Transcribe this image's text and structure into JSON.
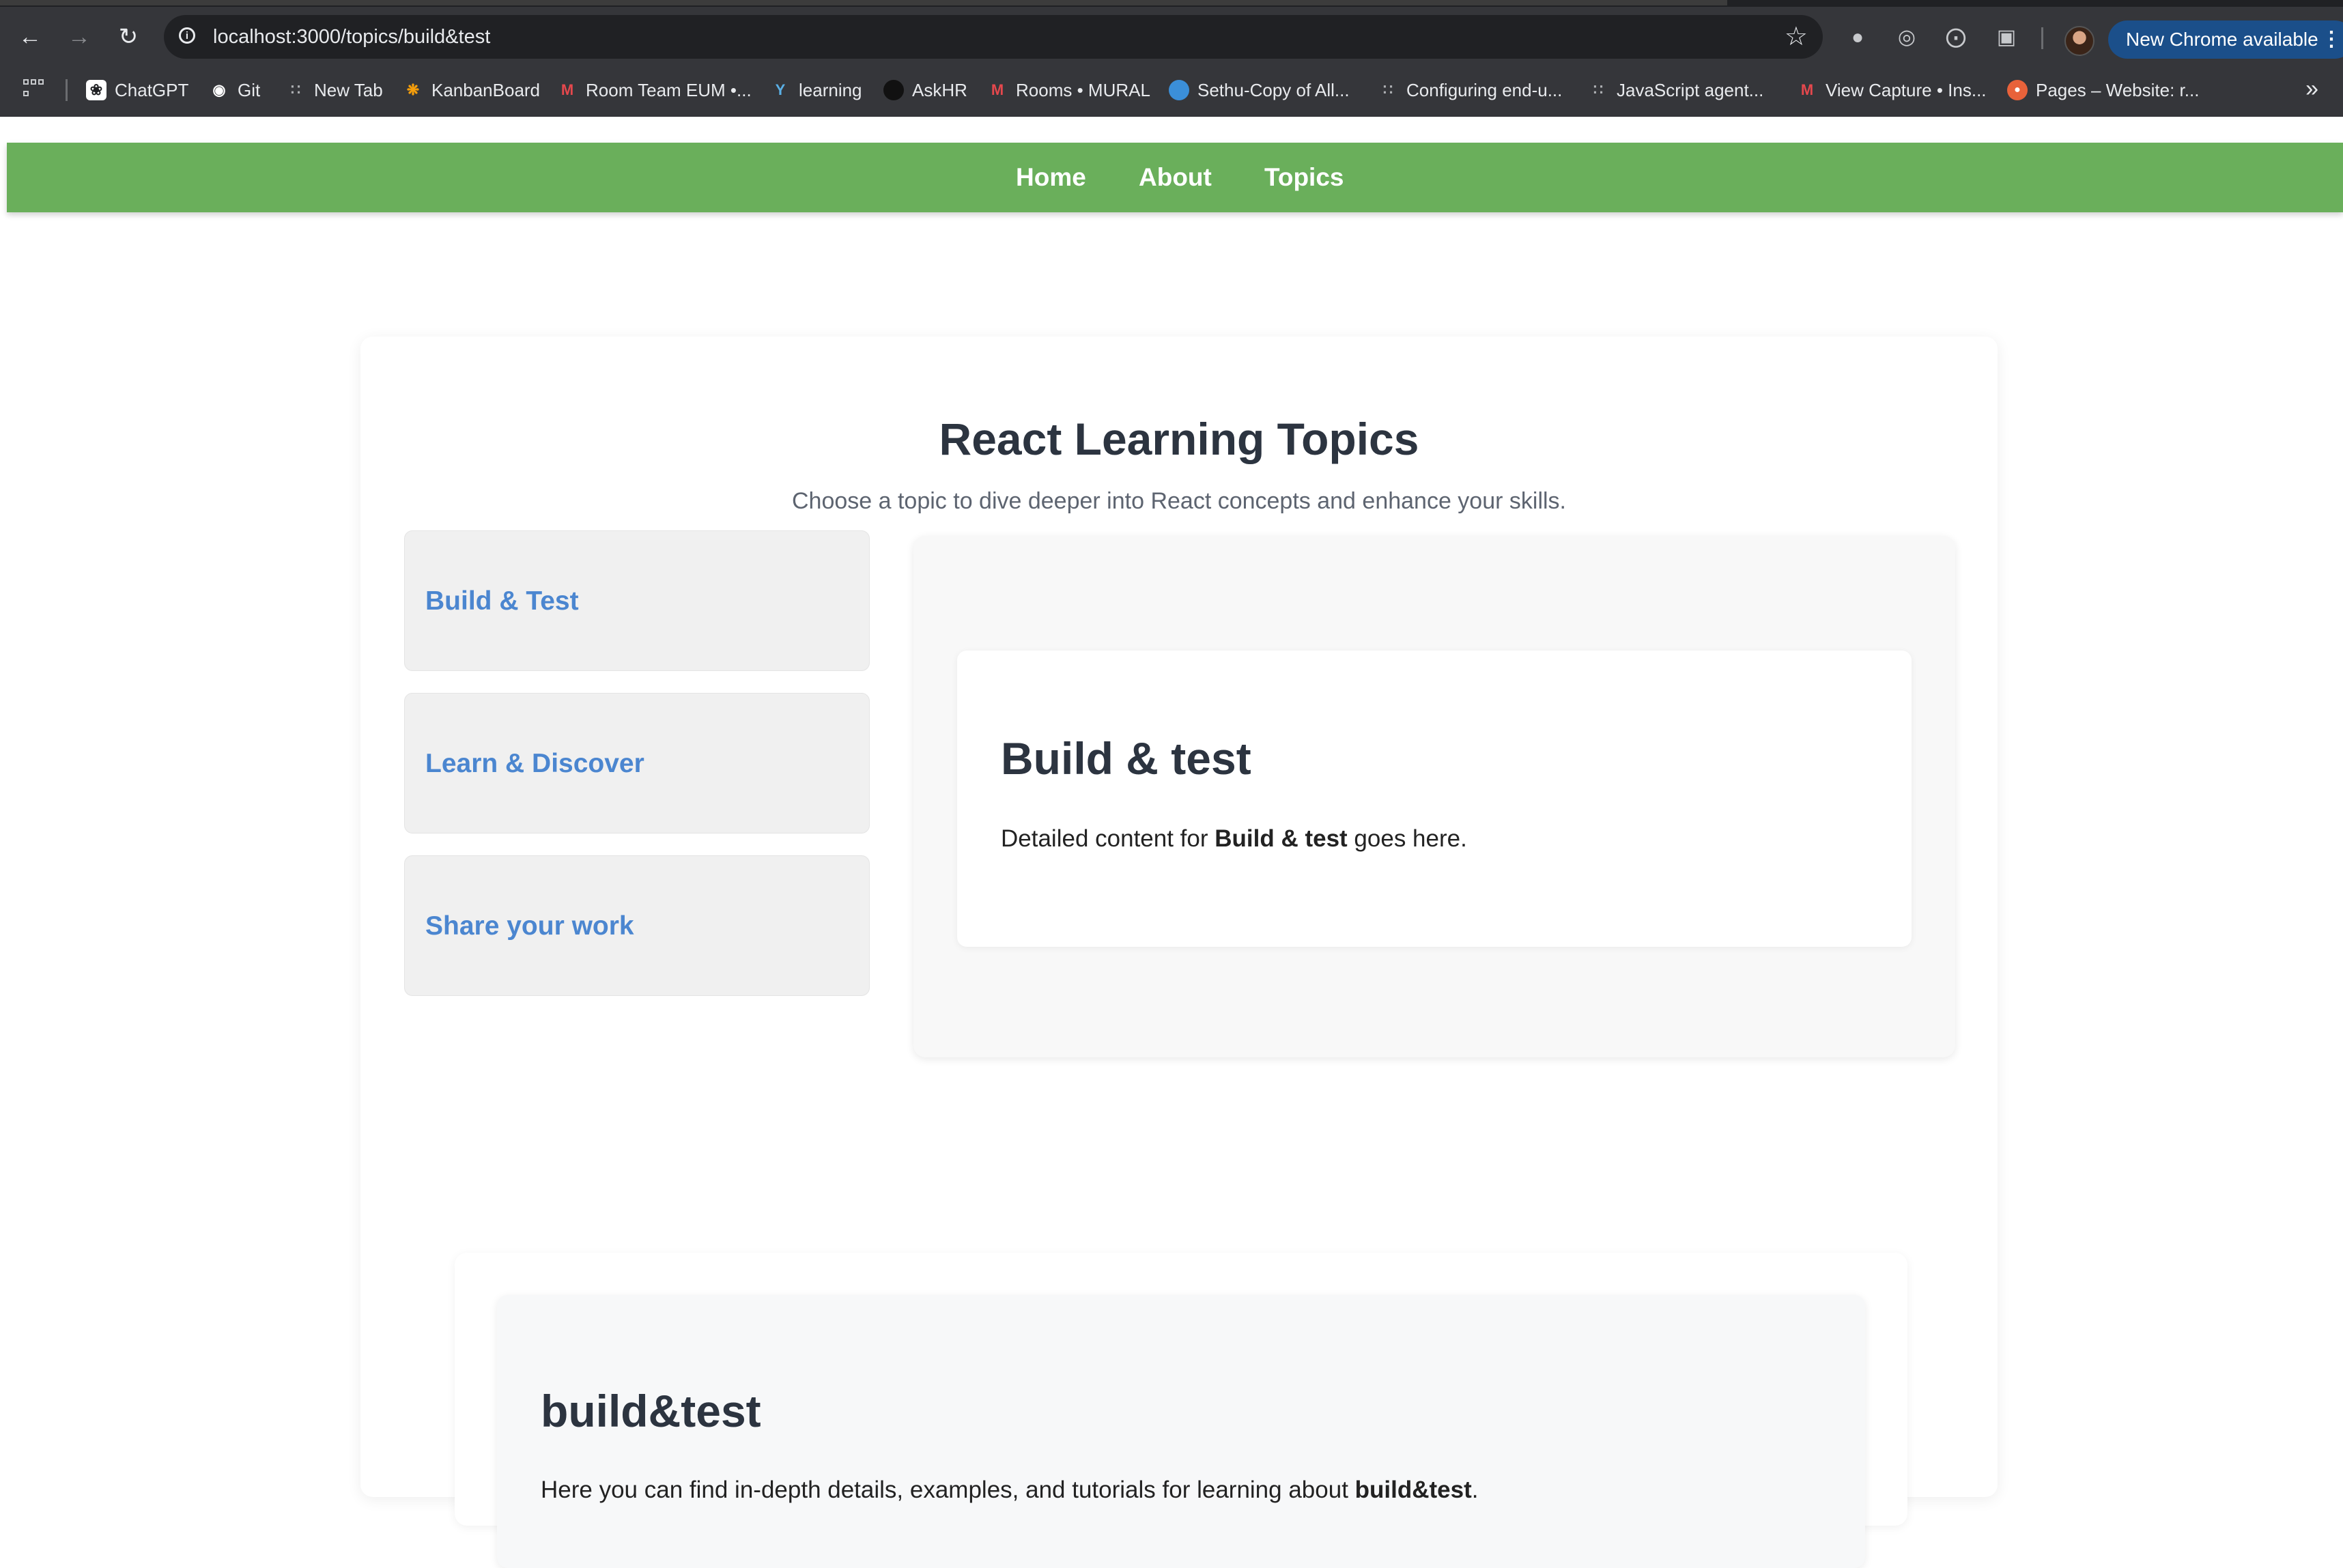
{
  "browser": {
    "url": "localhost:3000/topics/build&test",
    "update_label": "New Chrome available",
    "bookmarks": [
      {
        "label": "ChatGPT",
        "icon": "chatgpt-icon"
      },
      {
        "label": "Git",
        "icon": "github-icon"
      },
      {
        "label": "New Tab",
        "icon": "tab-icon"
      },
      {
        "label": "KanbanBoard",
        "icon": "kanban-icon"
      },
      {
        "label": "Room Team EUM •...",
        "icon": "mural-icon"
      },
      {
        "label": "learning",
        "icon": "learning-icon"
      },
      {
        "label": "AskHR",
        "icon": "askhr-icon"
      },
      {
        "label": "Rooms • MURAL",
        "icon": "mural-icon"
      },
      {
        "label": "Sethu-Copy of All...",
        "icon": "salesforce-icon"
      },
      {
        "label": "Configuring end-u...",
        "icon": "doc-icon"
      },
      {
        "label": "JavaScript agent...",
        "icon": "doc-icon"
      },
      {
        "label": "View Capture • Ins...",
        "icon": "mural-icon"
      },
      {
        "label": "Pages – Website: r...",
        "icon": "pages-icon"
      }
    ]
  },
  "nav": {
    "home": "Home",
    "about": "About",
    "topics": "Topics"
  },
  "page": {
    "title": "React Learning Topics",
    "subtitle": "Choose a topic to dive deeper into React concepts and enhance your skills.",
    "topics": [
      "Build & Test",
      "Learn & Discover",
      "Share your work"
    ]
  },
  "detail": {
    "title": "Build & test",
    "text_before": "Detailed content for ",
    "text_bold": "Build & test",
    "text_after": " goes here."
  },
  "lower": {
    "title": "build&test",
    "text_before": "Here you can find in-depth details, examples, and tutorials for learning about ",
    "text_bold": "build&test",
    "text_after": "."
  },
  "colors": {
    "nav_green": "#6aaf5b",
    "topic_link": "#4b86d0",
    "heading": "#2c3440"
  }
}
